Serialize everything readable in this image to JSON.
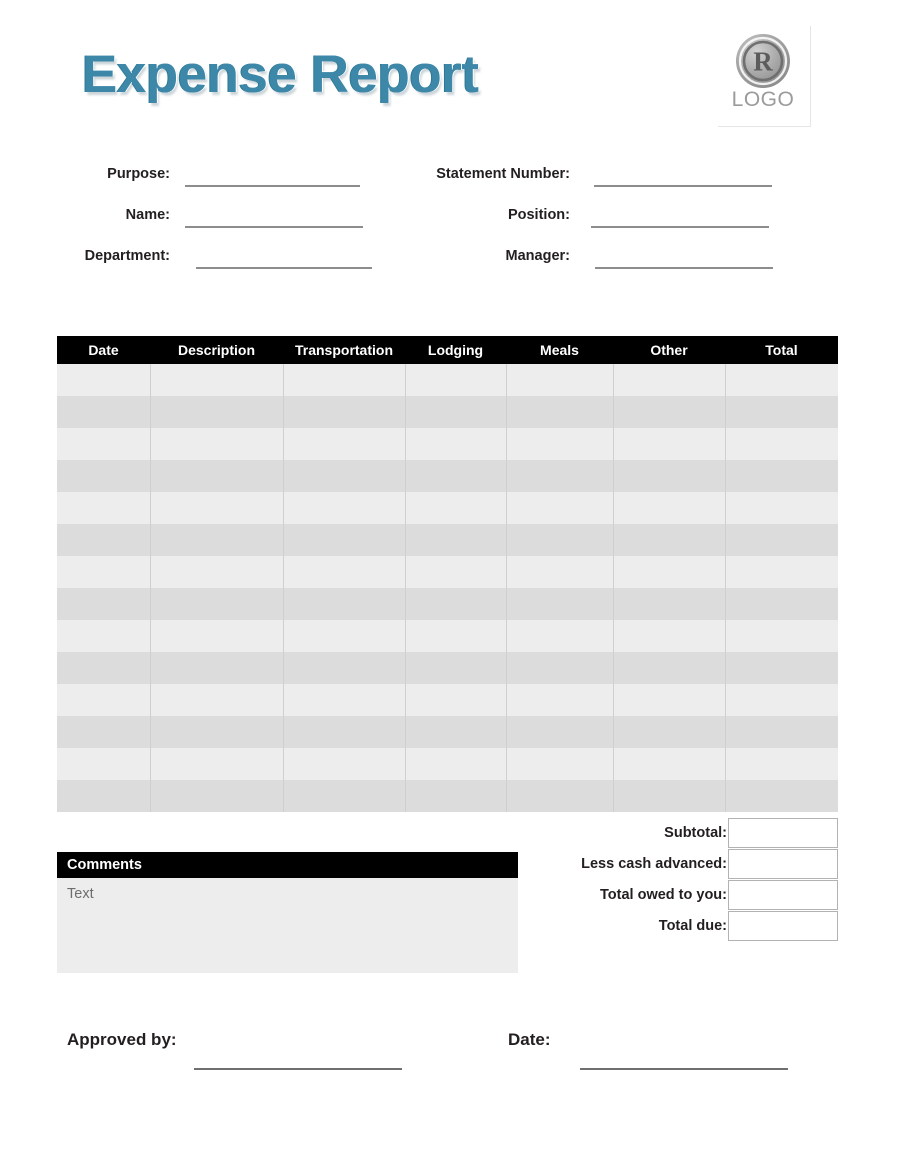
{
  "header": {
    "title": "Expense Report",
    "logo": {
      "mark": "registered-trademark",
      "label": "LOGO"
    },
    "title_color": "#3d87a8"
  },
  "info": {
    "left": [
      {
        "label": "Purpose:"
      },
      {
        "label": "Name:"
      },
      {
        "label": "Department:"
      }
    ],
    "right": [
      {
        "label": "Statement Number:"
      },
      {
        "label": "Position:"
      },
      {
        "label": "Manager:"
      }
    ]
  },
  "table": {
    "columns": [
      "Date",
      "Description",
      "Transportation",
      "Lodging",
      "Meals",
      "Other",
      "Total"
    ],
    "row_count": 14,
    "rows": [
      [
        "",
        "",
        "",
        "",
        "",
        "",
        ""
      ],
      [
        "",
        "",
        "",
        "",
        "",
        "",
        ""
      ],
      [
        "",
        "",
        "",
        "",
        "",
        "",
        ""
      ],
      [
        "",
        "",
        "",
        "",
        "",
        "",
        ""
      ],
      [
        "",
        "",
        "",
        "",
        "",
        "",
        ""
      ],
      [
        "",
        "",
        "",
        "",
        "",
        "",
        ""
      ],
      [
        "",
        "",
        "",
        "",
        "",
        "",
        ""
      ],
      [
        "",
        "",
        "",
        "",
        "",
        "",
        ""
      ],
      [
        "",
        "",
        "",
        "",
        "",
        "",
        ""
      ],
      [
        "",
        "",
        "",
        "",
        "",
        "",
        ""
      ],
      [
        "",
        "",
        "",
        "",
        "",
        "",
        ""
      ],
      [
        "",
        "",
        "",
        "",
        "",
        "",
        ""
      ],
      [
        "",
        "",
        "",
        "",
        "",
        "",
        ""
      ],
      [
        "",
        "",
        "",
        "",
        "",
        "",
        ""
      ]
    ],
    "header_bg": "#000000",
    "row_bg_odd": "#ededed",
    "row_bg_even": "#dcdcdc"
  },
  "totals": [
    {
      "label": "Subtotal:",
      "value": ""
    },
    {
      "label": "Less cash advanced:",
      "value": ""
    },
    {
      "label": "Total owed to you:",
      "value": ""
    },
    {
      "label": "Total due:",
      "value": ""
    }
  ],
  "comments": {
    "title": "Comments",
    "placeholder": "Text",
    "value": "Text"
  },
  "footer": {
    "approved_label": "Approved by:",
    "date_label": "Date:"
  }
}
